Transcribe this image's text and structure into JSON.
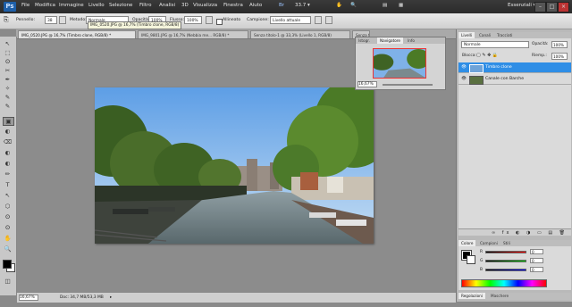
{
  "app": {
    "logo": "Ps",
    "workspace": "Essenziali ▾",
    "zoom_display": "33.7 ▾"
  },
  "menu": [
    "File",
    "Modifica",
    "Immagine",
    "Livello",
    "Selezione",
    "Filtro",
    "Analisi",
    "3D",
    "Visualizza",
    "Finestra",
    "Aiuto"
  ],
  "window_buttons": [
    "–",
    "□",
    "×"
  ],
  "options": {
    "brush_label": "Pennello:",
    "brush_size": "38",
    "mode_label": "Metodo:",
    "mode_value": "Normale",
    "opacity_label": "Opacità:",
    "opacity_value": "100%",
    "flow_label": "Flusso:",
    "flow_value": "100%",
    "aligned_label": "Allineato",
    "sample_label": "Campione:",
    "sample_value": "Livello attuale"
  },
  "tooltip": "IMG_0520.JPG @ 16,7% (Timbro clone, RGB/8)",
  "doc_tabs": [
    {
      "label": "IMG_0520.JPG @ 16,7% (Timbro clone, RGB/8) *",
      "close": "×"
    },
    {
      "label": "IMG_9801.JPG @ 16,7% (Nebbia me... RGB/8) *",
      "close": "×"
    },
    {
      "label": "Senza titolo-1 @ 33,3% (Livello 1, RGB/8)",
      "close": "×"
    },
    {
      "label": "Senza titolo-2 @ 50% (Livello 1, RGB/8)",
      "close": "×"
    }
  ],
  "status": {
    "zoom": "16,67%",
    "doc": "Doc: 34,7 MB/53,3 MB",
    "arrow": "▸"
  },
  "navigator": {
    "tabs": [
      "Istogr.",
      "Navigatore",
      "Info"
    ],
    "zoom": "16,67%"
  },
  "layers": {
    "tabs": [
      "Livelli",
      "Canali",
      "Tracciati"
    ],
    "blend_mode": "Normale",
    "opacity_label": "Opacità:",
    "opacity_value": "100%",
    "lock_label": "Blocca:",
    "fill_label": "Riemp.:",
    "fill_value": "100%",
    "items": [
      {
        "name": "Timbro clone",
        "selected": true
      },
      {
        "name": "Canale con Barche",
        "selected": false
      }
    ],
    "footer_icons": [
      "link-icon",
      "fx-icon",
      "mask-icon",
      "adjustment-icon",
      "folder-icon",
      "new-layer-icon",
      "trash-icon"
    ]
  },
  "color": {
    "tabs": [
      "Colore",
      "Campioni",
      "Stili"
    ],
    "labels": [
      "R",
      "G",
      "B"
    ],
    "values": [
      "0",
      "0",
      "0"
    ]
  },
  "bottom_tabs": [
    "Regolazioni",
    "Maschere"
  ],
  "tools": [
    "↖",
    "⬚",
    "ʘ",
    "✂",
    "✒",
    "✧",
    "✎",
    "⌫",
    "▣",
    "◐",
    "✏",
    "T",
    "⬡",
    "✋",
    "🔍"
  ],
  "colors": {
    "accent": "#2f8ee6",
    "menubar": "#2b2b2b",
    "canvas_bg": "#8c8c8c"
  }
}
